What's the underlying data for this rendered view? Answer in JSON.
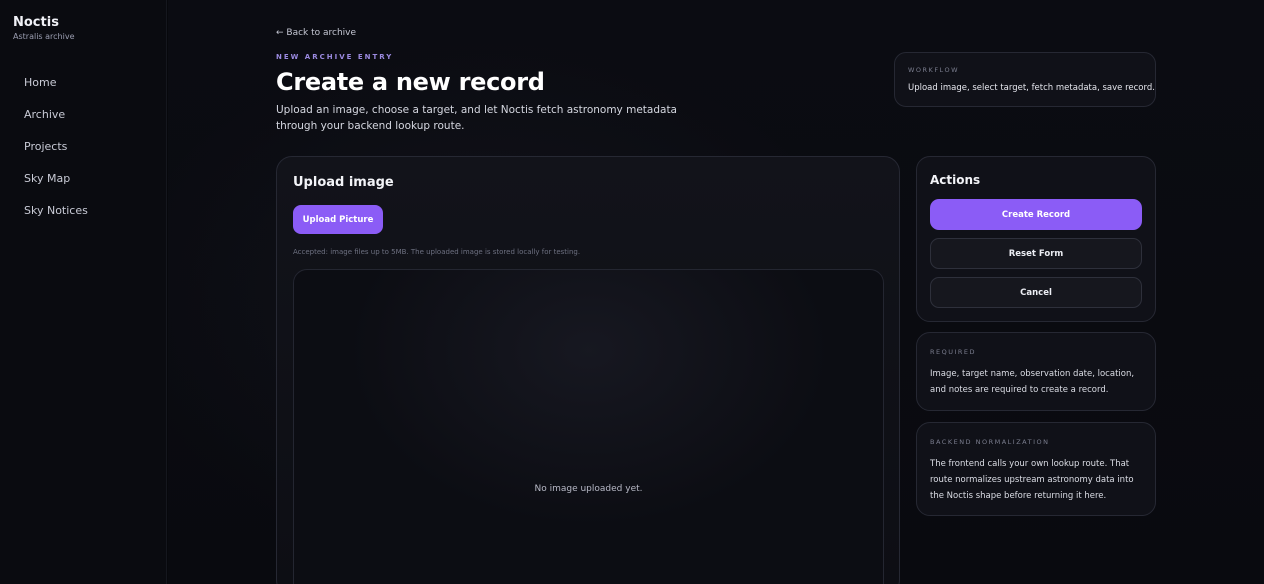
{
  "sidebar": {
    "brand_title": "Noctis",
    "brand_subtitle": "Astralis archive",
    "items": [
      {
        "label": "Home"
      },
      {
        "label": "Archive"
      },
      {
        "label": "Projects"
      },
      {
        "label": "Sky Map"
      },
      {
        "label": "Sky Notices"
      }
    ]
  },
  "header": {
    "back_link": "← Back to archive",
    "eyebrow": "NEW ARCHIVE ENTRY",
    "title": "Create a new record",
    "description": "Upload an image, choose a target, and let Noctis fetch astronomy metadata through your backend lookup route."
  },
  "workflow": {
    "eyebrow": "WORKFLOW",
    "text": "Upload image, select target, fetch metadata, save record."
  },
  "upload": {
    "title": "Upload image",
    "button_label": "Upload Picture",
    "hint": "Accepted: image files up to 5MB. The uploaded image is stored locally for testing.",
    "empty_text": "No image uploaded yet."
  },
  "actions": {
    "title": "Actions",
    "create_label": "Create Record",
    "reset_label": "Reset Form",
    "cancel_label": "Cancel"
  },
  "required": {
    "eyebrow": "REQUIRED",
    "text": "Image, target name, observation date, location, and notes are required to create a record."
  },
  "backend": {
    "eyebrow": "BACKEND NORMALIZATION",
    "text": "The frontend calls your own lookup route. That route normalizes upstream astronomy data into the Noctis shape before returning it here."
  },
  "colors": {
    "accent": "#8b5cf6",
    "background": "#07080c",
    "eyebrow": "#9b8ae0"
  }
}
